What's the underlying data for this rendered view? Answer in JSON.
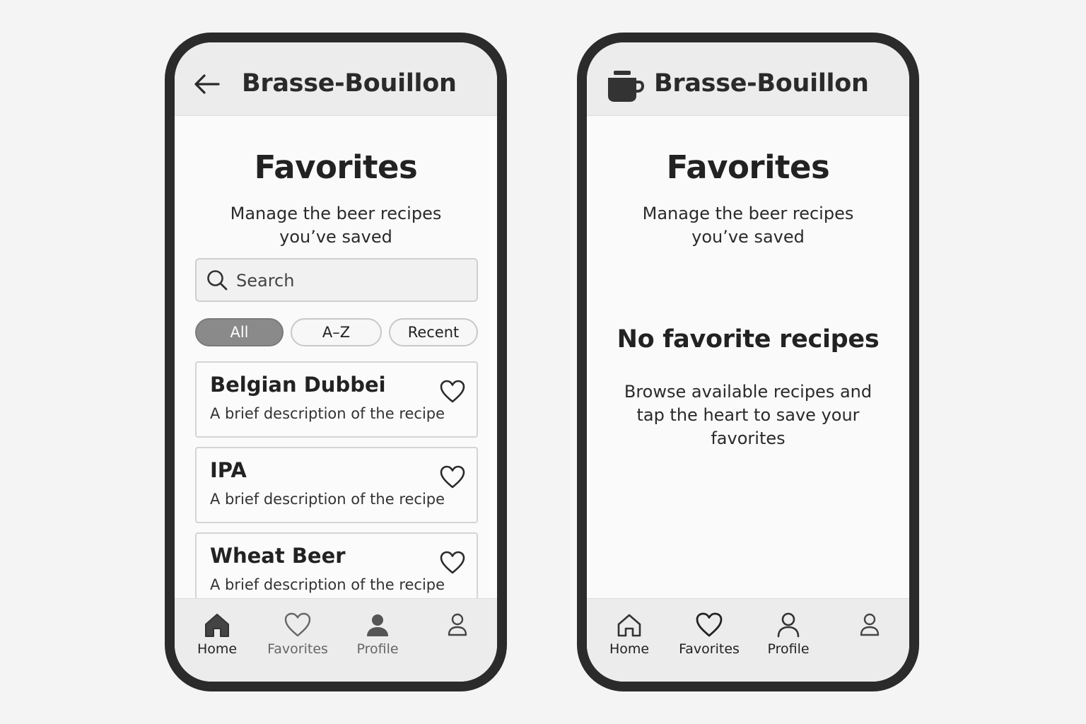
{
  "app": {
    "title": "Brasse-Bouillon"
  },
  "left_screen": {
    "page_title": "Favorites",
    "page_subtitle": "Manage the beer recipes you’ve saved",
    "search": {
      "placeholder": "Search",
      "value": ""
    },
    "filters": [
      {
        "label": "All",
        "active": true
      },
      {
        "label": "A–Z",
        "active": false
      },
      {
        "label": "Recent",
        "active": false
      }
    ],
    "recipes": [
      {
        "name": "Belgian Dubbei",
        "description": "A brief description of the recipe",
        "icon": "heart-outline-icon"
      },
      {
        "name": "IPA",
        "description": "A brief description of the recipe",
        "icon": "heart-outline-icon"
      },
      {
        "name": "Wheat Beer",
        "description": "A brief description of the recipe",
        "icon": "heart-outline-icon"
      }
    ],
    "nav": [
      {
        "label": "Home",
        "icon": "home-filled-icon"
      },
      {
        "label": "Favorites",
        "icon": "heart-outline-icon"
      },
      {
        "label": "Profile",
        "icon": "user-filled-icon"
      },
      {
        "label": "",
        "icon": "user-outline-icon"
      }
    ]
  },
  "right_screen": {
    "page_title": "Favorites",
    "page_subtitle": "Manage the beer recipes you’ve saved",
    "empty_state": {
      "title": "No favorite recipes",
      "text": "Browse available recipes and tap the heart to save your favorites"
    },
    "nav": [
      {
        "label": "Home",
        "icon": "home-outline-icon"
      },
      {
        "label": "Favorites",
        "icon": "heart-outline-icon"
      },
      {
        "label": "Profile",
        "icon": "user-outline-icon"
      },
      {
        "label": "",
        "icon": "user-outline-icon"
      }
    ]
  },
  "colors": {
    "frame": "#2b2b2b",
    "header_bg": "#ececec",
    "active_chip": "#8a8a8a"
  }
}
